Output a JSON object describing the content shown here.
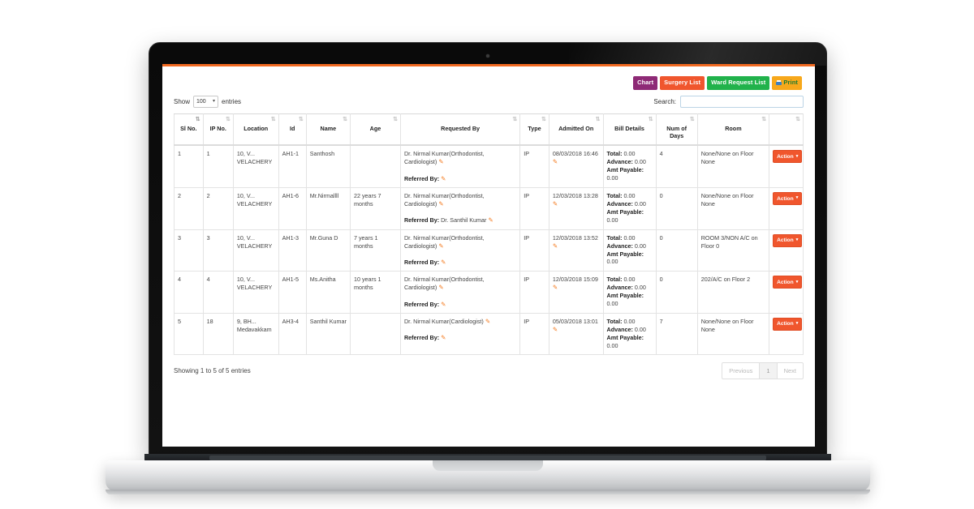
{
  "toolbar": {
    "buttons": [
      {
        "label": "Chart",
        "color": "#8e2a76",
        "name": "chart-button"
      },
      {
        "label": "Surgery List",
        "color": "#f0562d",
        "name": "surgery-list-button"
      },
      {
        "label": "Ward Request List",
        "color": "#21b24b",
        "name": "ward-request-list-button"
      },
      {
        "label": "Print",
        "color": "#f7a81b",
        "name": "print-button"
      }
    ]
  },
  "controls": {
    "show_label": "Show",
    "entries_label": "entries",
    "page_length": "100",
    "caret": "▾",
    "search_label": "Search:",
    "search_value": "",
    "search_placeholder": ""
  },
  "table": {
    "columns": [
      {
        "label": "Sl No.",
        "sort": "⇅",
        "active": true
      },
      {
        "label": "IP No.",
        "sort": "⇅",
        "active": false
      },
      {
        "label": "Location",
        "sort": "⇅",
        "active": false
      },
      {
        "label": "Id",
        "sort": "⇅",
        "active": false
      },
      {
        "label": "Name",
        "sort": "⇅",
        "active": false
      },
      {
        "label": "Age",
        "sort": "⇅",
        "active": false
      },
      {
        "label": "Requested By",
        "sort": "⇅",
        "active": false
      },
      {
        "label": "Type",
        "sort": "⇅",
        "active": false
      },
      {
        "label": "Admitted On",
        "sort": "⇅",
        "active": false
      },
      {
        "label": "Bill Details",
        "sort": "⇅",
        "active": false
      },
      {
        "label": "Num of Days",
        "sort": "⇅",
        "active": false
      },
      {
        "label": "Room",
        "sort": "⇅",
        "active": false
      },
      {
        "label": "",
        "sort": "⇅",
        "active": false
      }
    ],
    "bill_labels": {
      "total": "Total:",
      "advance": "Advance:",
      "payable": "Amt Payable:"
    },
    "referred_label": "Referred By:",
    "action_label": "Action",
    "action_caret": "▾",
    "pencil": "✎",
    "rows": [
      {
        "sl": "1",
        "ip": "1",
        "location": "10, V... VELACHERY",
        "id": "AH1-1",
        "name": "Santhosh",
        "age": "",
        "requested_by": "Dr. Nirmal Kumar(Orthodontist, Cardiologist)",
        "referred_by": "",
        "type": "IP",
        "admitted_on": "08/03/2018 16:46",
        "bill_total": "0.00",
        "bill_advance": "0.00",
        "bill_payable": "0.00",
        "num_days": "4",
        "room": "None/None on Floor None"
      },
      {
        "sl": "2",
        "ip": "2",
        "location": "10, V... VELACHERY",
        "id": "AH1-6",
        "name": "Mr.Nirmallll",
        "age": "22 years 7 months",
        "requested_by": "Dr. Nirmal Kumar(Orthodontist, Cardiologist)",
        "referred_by": "Dr. Santhil Kumar",
        "type": "IP",
        "admitted_on": "12/03/2018 13:28",
        "bill_total": "0.00",
        "bill_advance": "0.00",
        "bill_payable": "0.00",
        "num_days": "0",
        "room": "None/None on Floor None"
      },
      {
        "sl": "3",
        "ip": "3",
        "location": "10, V... VELACHERY",
        "id": "AH1-3",
        "name": "Mr.Guna D",
        "age": "7 years 1 months",
        "requested_by": "Dr. Nirmal Kumar(Orthodontist, Cardiologist)",
        "referred_by": "",
        "type": "IP",
        "admitted_on": "12/03/2018 13:52",
        "bill_total": "0.00",
        "bill_advance": "0.00",
        "bill_payable": "0.00",
        "num_days": "0",
        "room": "ROOM 3/NON A/C on Floor 0"
      },
      {
        "sl": "4",
        "ip": "4",
        "location": "10, V... VELACHERY",
        "id": "AH1-5",
        "name": "Ms.Anitha",
        "age": "10 years 1 months",
        "requested_by": "Dr. Nirmal Kumar(Orthodontist, Cardiologist)",
        "referred_by": "",
        "type": "IP",
        "admitted_on": "12/03/2018 15:09",
        "bill_total": "0.00",
        "bill_advance": "0.00",
        "bill_payable": "0.00",
        "num_days": "0",
        "room": "202/A/C on Floor 2"
      },
      {
        "sl": "5",
        "ip": "18",
        "location": "9, BH... Medavakkam",
        "id": "AH3-4",
        "name": "Santhil Kumar",
        "age": "",
        "requested_by": "Dr. Nirmal Kumar(Cardiologist)",
        "referred_by": "",
        "type": "IP",
        "admitted_on": "05/03/2018 13:01",
        "bill_total": "0.00",
        "bill_advance": "0.00",
        "bill_payable": "0.00",
        "num_days": "7",
        "room": "None/None on Floor None"
      }
    ]
  },
  "footer": {
    "showing": "Showing 1 to 5 of 5 entries",
    "previous": "Previous",
    "page_number": "1",
    "next": "Next"
  }
}
